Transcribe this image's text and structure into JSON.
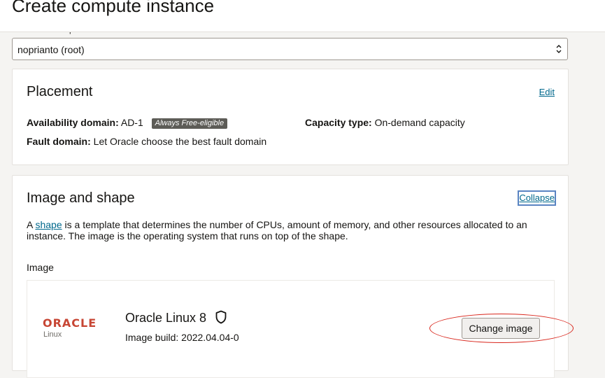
{
  "page": {
    "title": "Create compute instance"
  },
  "compartment": {
    "label": "Create in compartment",
    "value": "noprianto (root)"
  },
  "placement": {
    "title": "Placement",
    "edit_label": "Edit",
    "availability_domain_label": "Availability domain:",
    "availability_domain_value": "AD-1",
    "availability_badge": "Always Free-eligible",
    "capacity_type_label": "Capacity type:",
    "capacity_type_value": "On-demand capacity",
    "fault_domain_label": "Fault domain:",
    "fault_domain_value": "Let Oracle choose the best fault domain"
  },
  "image_shape": {
    "title": "Image and shape",
    "collapse_label": "Collapse",
    "description_prefix": "A",
    "shape_link": "shape",
    "description_rest": "is a template that determines the number of CPUs, amount of memory, and other resources allocated to an instance. The image is the operating system that runs on top of the shape.",
    "image_label": "Image",
    "image": {
      "logo_text": "ORACLE",
      "logo_subtext": "Linux",
      "name": "Oracle Linux 8",
      "build": "Image build: 2022.04.04-0",
      "change_button": "Change image"
    }
  },
  "icons": {
    "select": "updown-chevron-icon",
    "security": "shield-icon"
  },
  "colors": {
    "link": "#00688c",
    "oracle_red": "#c74634",
    "badge_bg": "#5d5c57",
    "annotation": "#d9261c"
  }
}
